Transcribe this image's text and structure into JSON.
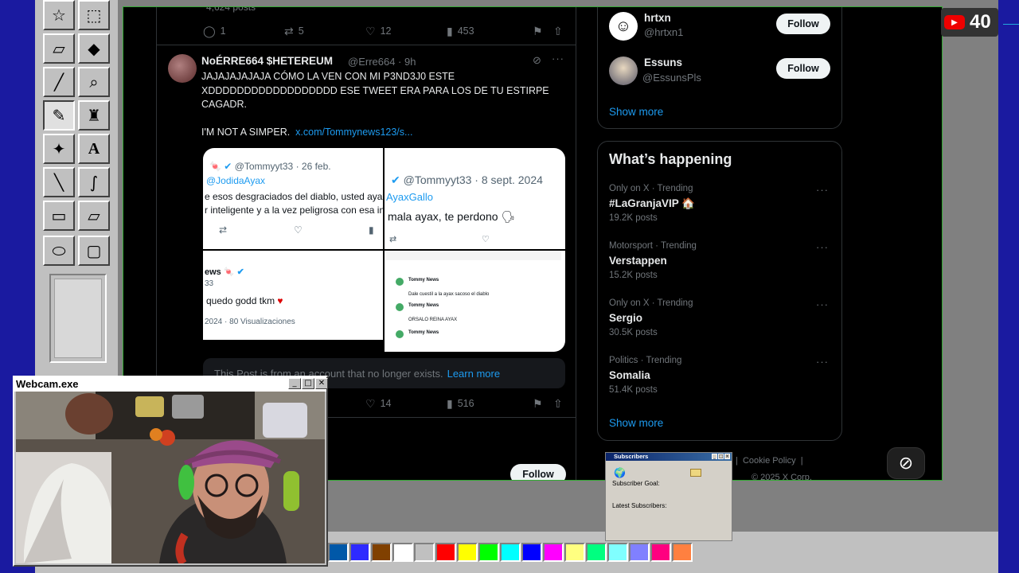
{
  "top_post": {
    "views": "4,624 posts",
    "actions": {
      "replies": "1",
      "reposts": "5",
      "likes": "12",
      "views": "453"
    }
  },
  "post": {
    "name": "NoÉRRE664 $HETEREUM",
    "handle": "@Erre664 · 9h",
    "text_line1": "JAJAJAJAJAJA CÓMO LA VEN CON MI P3ND3J0 ESTE",
    "text_line2": "XDDDDDDDDDDDDDDDDDD ESE TWEET ERA PARA LOS DE TU ESTIRPE",
    "text_line3": "CAGADR.",
    "text_line4": "I'M NOT A SIMPER.",
    "link": "x.com/Tommynews123/s...",
    "media": {
      "cell1_handle": "@Tommyyt33 · 26 feb.",
      "cell1_reply": "@JodidaAyax",
      "cell1_text": "e esos desgraciados del diablo, usted ayax",
      "cell1_text2": "r  inteligente y a la vez peligrosa con esa in",
      "cell2_handle": "@Tommyyt33 · 8 sept. 2024",
      "cell2_reply": "AyaxGallo",
      "cell2_text": "mala ayax, te perdono",
      "cell3_name": "ews",
      "cell3_handle": "33",
      "cell3_text": "quedo godd tkm",
      "cell3_meta": "2024 · 80 Visualizaciones",
      "cell4_lines": [
        "Tommy News",
        "Dale cuestil a la ayax sacoso el diablo",
        "Tommy News",
        "ORSALO REINA AYAX",
        "Tommy News"
      ]
    },
    "notice": "This Post is from an account that no longer exists.",
    "notice_link": "Learn more",
    "actions": {
      "likes": "14",
      "views": "516"
    }
  },
  "bottom_follow": "Follow",
  "who_to_follow": {
    "users": [
      {
        "name": "hrtxn",
        "handle": "@hrtxn1",
        "button": "Follow"
      },
      {
        "name": "Essuns",
        "handle": "@EssunsPls",
        "button": "Follow"
      }
    ],
    "show_more": "Show more"
  },
  "whats_happening": {
    "title": "What’s happening",
    "trends": [
      {
        "meta": "Only on X · Trending",
        "name": "#LaGranjaVIP 🏠",
        "count": "19.2K posts"
      },
      {
        "meta": "Motorsport · Trending",
        "name": "Verstappen",
        "count": "15.2K posts"
      },
      {
        "meta": "Only on X · Trending",
        "name": "Sergio",
        "count": "30.5K posts"
      },
      {
        "meta": "Politics · Trending",
        "name": "Somalia",
        "count": "51.4K posts"
      }
    ],
    "show_more": "Show more"
  },
  "footer": {
    "cookie": "Cookie Policy",
    "copyright": "© 2025 X Corp."
  },
  "webcam": {
    "title": "Webcam.exe"
  },
  "subscribers": {
    "title": "Subscribers",
    "goal": "Subscriber Goal:",
    "latest": "Latest Subscribers:"
  },
  "yt_count": "40",
  "palette": [
    "#0058a8",
    "#2e2aff",
    "#804000",
    "#ffffff",
    "#c0c0c0",
    "#ff0000",
    "#ffff00",
    "#00ff00",
    "#00ffff",
    "#0000ff",
    "#ff00ff",
    "#ffff80",
    "#00ff80",
    "#80ffff",
    "#8080ff",
    "#ff0080",
    "#ff8040"
  ],
  "colors": {
    "accent": "#1d9bf0",
    "bg": "#000000",
    "paint_gray": "#c0c0c0"
  }
}
